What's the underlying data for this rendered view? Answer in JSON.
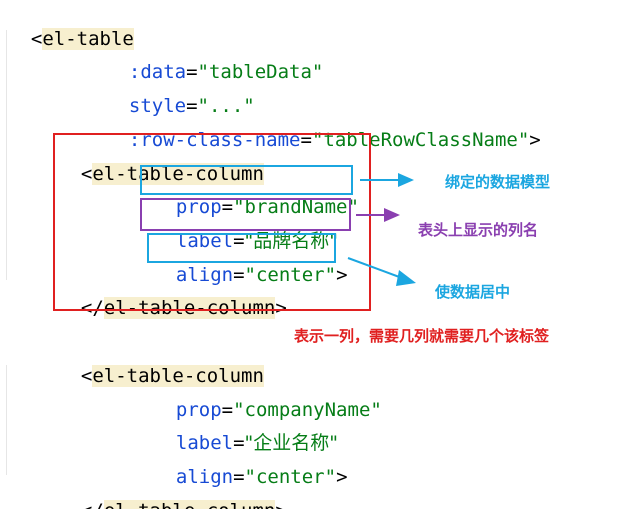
{
  "code": {
    "l1": {
      "open": "<",
      "tag": "el-table"
    },
    "l2": {
      "attr": ":data",
      "eq": "=",
      "val": "\"tableData\""
    },
    "l3": {
      "attr": "style",
      "eq": "=",
      "val": "\"...\""
    },
    "l4": {
      "attr": ":row-class-name",
      "eq": "=",
      "val": "\"tableRowClassName\"",
      "close": ">"
    },
    "l5": {
      "open": "<",
      "tag": "el-table-column"
    },
    "l6": {
      "attr": "prop",
      "eq": "=",
      "val": "\"brandName\""
    },
    "l7": {
      "attr": "label",
      "eq": "=",
      "val": "\"品牌名称\""
    },
    "l8": {
      "attr": "align",
      "eq": "=",
      "val": "\"center\"",
      "close": ">"
    },
    "l9": {
      "open": "</",
      "tag": "el-table-column",
      "close": ">"
    },
    "l10": {
      "open": "<",
      "tag": "el-table-column"
    },
    "l11": {
      "attr": "prop",
      "eq": "=",
      "val": "\"companyName\""
    },
    "l12": {
      "attr": "label",
      "eq": "=",
      "val": "\"企业名称\""
    },
    "l13": {
      "attr": "align",
      "eq": "=",
      "val": "\"center\"",
      "close": ">"
    },
    "l14": {
      "open": "</",
      "tag": "el-table-column",
      "close": ">"
    }
  },
  "annotations": {
    "prop": "绑定的数据模型",
    "label": "表头上显示的列名",
    "align": "使数据居中",
    "column": "表示一列，需要几列就需要几个该标签"
  },
  "colors": {
    "red": "#e02020",
    "blue": "#1ba6e0",
    "purple": "#8a3fb0",
    "attribute": "#174ad4",
    "string": "#067d17",
    "tag_highlight": "#f7efcf"
  }
}
